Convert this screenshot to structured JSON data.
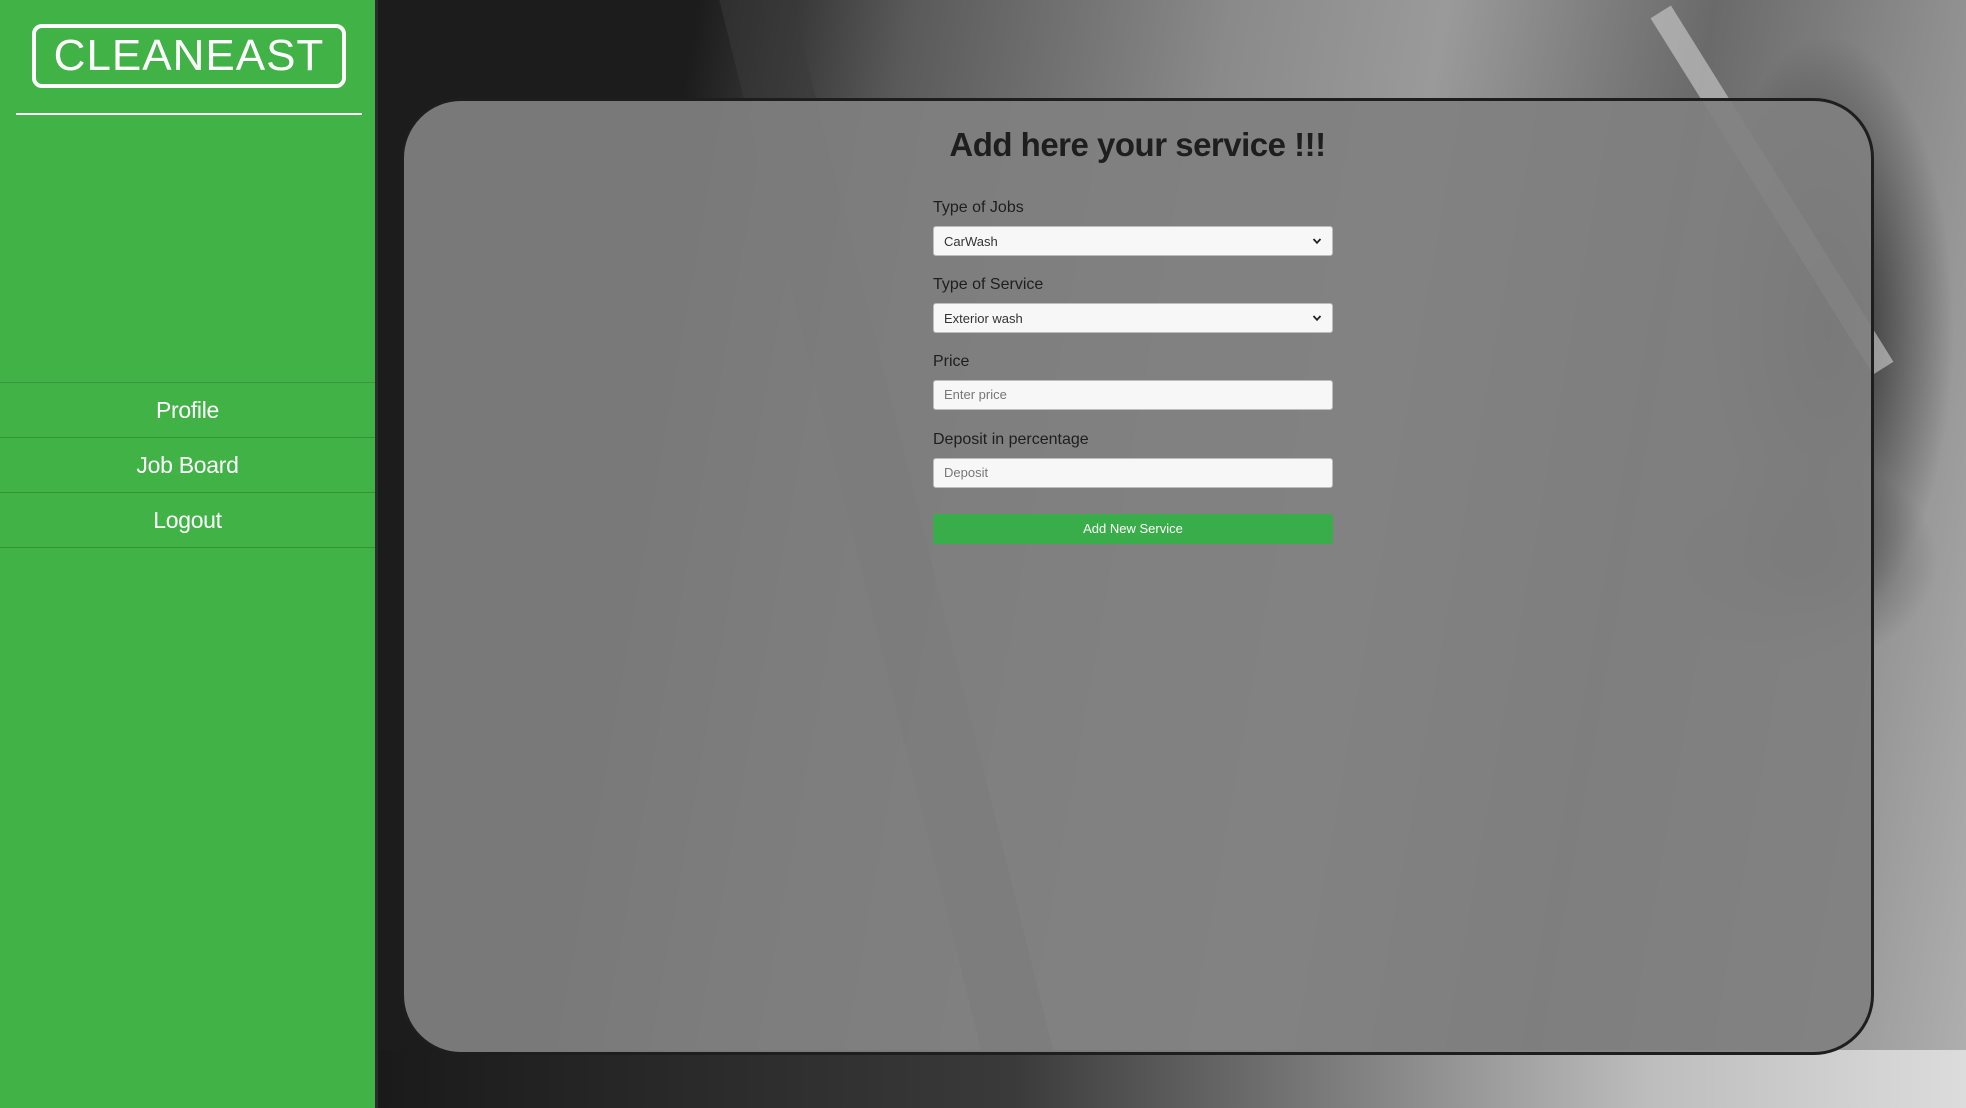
{
  "brand": {
    "logo_text": "CLEANEAST"
  },
  "sidebar": {
    "items": [
      {
        "label": "Profile"
      },
      {
        "label": "Job Board"
      },
      {
        "label": "Logout"
      }
    ]
  },
  "main": {
    "title": "Add here your service !!!",
    "form": {
      "job_type": {
        "label": "Type of Jobs",
        "selected": "CarWash"
      },
      "service_type": {
        "label": "Type of Service",
        "selected": "Exterior wash"
      },
      "price": {
        "label": "Price",
        "placeholder": "Enter price"
      },
      "deposit": {
        "label": "Deposit in percentage",
        "placeholder": "Deposit"
      },
      "submit_label": "Add New Service"
    }
  },
  "colors": {
    "sidebar": "#41b346",
    "button": "#39ad49",
    "panel": "#808080"
  }
}
